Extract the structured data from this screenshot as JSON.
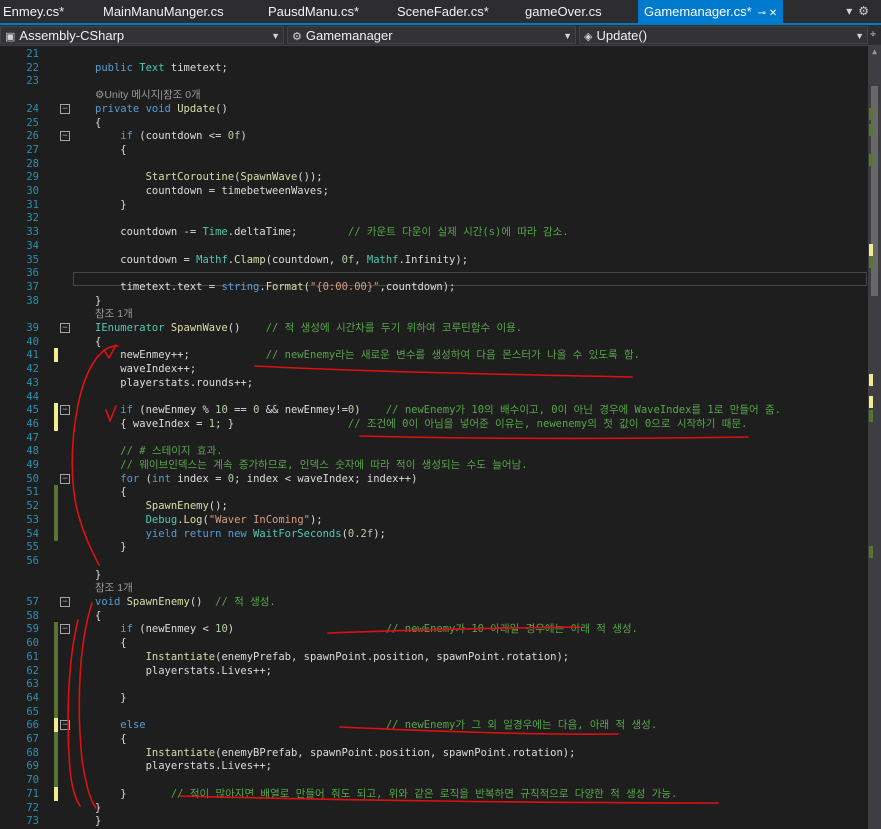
{
  "tabs": [
    {
      "label": "Enmey.cs*",
      "active": false
    },
    {
      "label": "MainManuManger.cs",
      "active": false
    },
    {
      "label": "PausdManu.cs*",
      "active": false
    },
    {
      "label": "SceneFader.cs*",
      "active": false
    },
    {
      "label": "gameOver.cs",
      "active": false
    },
    {
      "label": "Gamemanager.cs*",
      "active": true
    }
  ],
  "navbar": {
    "project": "Assembly-CSharp",
    "class": "Gamemanager",
    "member": "Update()"
  },
  "colors": {
    "accent": "#007acc",
    "editor_bg": "#1e1e1e",
    "annotation_ink": "#e01010",
    "keyword": "#569cd6",
    "type": "#4ec9b0",
    "comment": "#57a64a"
  },
  "lines": [
    {
      "n": "21",
      "segs": []
    },
    {
      "n": "22",
      "segs": [
        [
          "kw",
          "public "
        ],
        [
          "type",
          "Text "
        ],
        [
          "plain",
          "timetext;"
        ]
      ]
    },
    {
      "n": "23",
      "segs": []
    },
    {
      "lens": "⚙Unity 메시지|참조 0개"
    },
    {
      "n": "24",
      "fold": true,
      "segs": [
        [
          "kw",
          "private "
        ],
        [
          "kw",
          "void "
        ],
        [
          "fn",
          "Update"
        ],
        [
          "plain",
          "()"
        ]
      ]
    },
    {
      "n": "25",
      "segs": [
        [
          "plain",
          "{"
        ]
      ]
    },
    {
      "n": "26",
      "fold": true,
      "segs": [
        [
          "plain",
          "    "
        ],
        [
          "kw",
          "if "
        ],
        [
          "plain",
          "(countdown <= "
        ],
        [
          "num",
          "0f"
        ],
        [
          "plain",
          ")"
        ]
      ]
    },
    {
      "n": "27",
      "segs": [
        [
          "plain",
          "    {"
        ]
      ]
    },
    {
      "n": "28",
      "segs": []
    },
    {
      "n": "29",
      "segs": [
        [
          "plain",
          "        "
        ],
        [
          "fn",
          "StartCoroutine"
        ],
        [
          "plain",
          "("
        ],
        [
          "fn",
          "SpawnWave"
        ],
        [
          "plain",
          "());"
        ]
      ]
    },
    {
      "n": "30",
      "segs": [
        [
          "plain",
          "        countdown = timebetweenWaves;"
        ]
      ]
    },
    {
      "n": "31",
      "segs": [
        [
          "plain",
          "    }"
        ]
      ]
    },
    {
      "n": "32",
      "segs": []
    },
    {
      "n": "33",
      "segs": [
        [
          "plain",
          "    countdown -= "
        ],
        [
          "type",
          "Time"
        ],
        [
          "plain",
          ".deltaTime;        "
        ],
        [
          "cmt",
          "// 카운트 다운이 실제 시간(s)에 따라 감소."
        ]
      ]
    },
    {
      "n": "34",
      "segs": []
    },
    {
      "n": "35",
      "segs": [
        [
          "plain",
          "    countdown = "
        ],
        [
          "type",
          "Mathf"
        ],
        [
          "plain",
          "."
        ],
        [
          "fn",
          "Clamp"
        ],
        [
          "plain",
          "(countdown, "
        ],
        [
          "num",
          "0f"
        ],
        [
          "plain",
          ", "
        ],
        [
          "type",
          "Mathf"
        ],
        [
          "plain",
          ".Infinity);"
        ]
      ]
    },
    {
      "n": "36",
      "segs": []
    },
    {
      "n": "37",
      "segs": [
        [
          "plain",
          "    timetext.text = "
        ],
        [
          "kw",
          "string"
        ],
        [
          "plain",
          "."
        ],
        [
          "fn",
          "Format"
        ],
        [
          "plain",
          "("
        ],
        [
          "str",
          "\"{0:00.00}\""
        ],
        [
          "plain",
          ",countdown);"
        ]
      ]
    },
    {
      "n": "38",
      "segs": [
        [
          "plain",
          "}"
        ]
      ]
    },
    {
      "lens": "참조 1개"
    },
    {
      "n": "39",
      "fold": true,
      "segs": [
        [
          "type",
          "IEnumerator "
        ],
        [
          "fn",
          "SpawnWave"
        ],
        [
          "plain",
          "()    "
        ],
        [
          "cmt",
          "// 적 생성에 시간차를 두기 위하여 코루틴함수 이용."
        ]
      ]
    },
    {
      "n": "40",
      "segs": [
        [
          "plain",
          "{"
        ]
      ]
    },
    {
      "n": "41",
      "segs": [
        [
          "plain",
          "    newEnmey++;            "
        ],
        [
          "cmt",
          "// newEnemy라는 새로운 변수를 생성하여 다음 몬스터가 나올 수 있도록 함."
        ]
      ]
    },
    {
      "n": "42",
      "segs": [
        [
          "plain",
          "    waveIndex++;"
        ]
      ]
    },
    {
      "n": "43",
      "segs": [
        [
          "plain",
          "    playerstats.rounds++;"
        ]
      ]
    },
    {
      "n": "44",
      "segs": []
    },
    {
      "n": "45",
      "fold": true,
      "segs": [
        [
          "plain",
          "    "
        ],
        [
          "kw",
          "if "
        ],
        [
          "plain",
          "(newEnmey % "
        ],
        [
          "num",
          "10"
        ],
        [
          "plain",
          " == "
        ],
        [
          "num",
          "0"
        ],
        [
          "plain",
          " && newEnmey!="
        ],
        [
          "num",
          "0"
        ],
        [
          "plain",
          ")    "
        ],
        [
          "cmt",
          "// newEnemy가 10의 배수이고, 0이 아닌 경우에 WaveIndex를 1로 만들어 줌."
        ]
      ]
    },
    {
      "n": "46",
      "segs": [
        [
          "plain",
          "    { waveIndex = "
        ],
        [
          "num",
          "1"
        ],
        [
          "plain",
          "; }                  "
        ],
        [
          "cmt",
          "// 조건에 0이 아님을 넣어준 이유는, newenemy의 첫 값이 0으로 시작하기 때문."
        ]
      ]
    },
    {
      "n": "47",
      "segs": []
    },
    {
      "n": "48",
      "segs": [
        [
          "plain",
          "    "
        ],
        [
          "cmt",
          "// # 스테이지 효과."
        ]
      ]
    },
    {
      "n": "49",
      "segs": [
        [
          "plain",
          "    "
        ],
        [
          "cmt",
          "// 웨이브인덱스는 계속 증가하므로, 인덱스 숫자에 따라 적이 생성되는 수도 늘어남."
        ]
      ]
    },
    {
      "n": "50",
      "fold": true,
      "segs": [
        [
          "plain",
          "    "
        ],
        [
          "kw",
          "for "
        ],
        [
          "plain",
          "("
        ],
        [
          "kw",
          "int "
        ],
        [
          "plain",
          "index = "
        ],
        [
          "num",
          "0"
        ],
        [
          "plain",
          "; index < waveIndex; index++)"
        ]
      ]
    },
    {
      "n": "51",
      "segs": [
        [
          "plain",
          "    {"
        ]
      ]
    },
    {
      "n": "52",
      "segs": [
        [
          "plain",
          "        "
        ],
        [
          "fn",
          "SpawnEnemy"
        ],
        [
          "plain",
          "();"
        ]
      ]
    },
    {
      "n": "53",
      "segs": [
        [
          "plain",
          "        "
        ],
        [
          "type",
          "Debug"
        ],
        [
          "plain",
          "."
        ],
        [
          "fn",
          "Log"
        ],
        [
          "plain",
          "("
        ],
        [
          "str",
          "\"Waver InComing\""
        ],
        [
          "plain",
          ");"
        ]
      ]
    },
    {
      "n": "54",
      "segs": [
        [
          "plain",
          "        "
        ],
        [
          "kw",
          "yield return new "
        ],
        [
          "type",
          "WaitForSeconds"
        ],
        [
          "plain",
          "("
        ],
        [
          "num",
          "0.2f"
        ],
        [
          "plain",
          ");"
        ]
      ]
    },
    {
      "n": "55",
      "segs": [
        [
          "plain",
          "    }"
        ]
      ]
    },
    {
      "n": "56",
      "segs": []
    },
    {
      "n": "",
      "segs": [
        [
          "plain",
          "}"
        ]
      ]
    },
    {
      "lens": "참조 1개"
    },
    {
      "n": "57",
      "fold": true,
      "segs": [
        [
          "kw",
          "void "
        ],
        [
          "fn",
          "SpawnEnemy"
        ],
        [
          "plain",
          "()  "
        ],
        [
          "cmt",
          "// 적 생성."
        ]
      ]
    },
    {
      "n": "58",
      "segs": [
        [
          "plain",
          "{"
        ]
      ]
    },
    {
      "n": "59",
      "fold": true,
      "segs": [
        [
          "plain",
          "    "
        ],
        [
          "kw",
          "if "
        ],
        [
          "plain",
          "(newEnmey < "
        ],
        [
          "num",
          "10"
        ],
        [
          "plain",
          ")                        "
        ],
        [
          "cmt",
          "// newEnemy가 10 아래일 경우에는 아래 적 생성."
        ]
      ]
    },
    {
      "n": "60",
      "segs": [
        [
          "plain",
          "    {"
        ]
      ]
    },
    {
      "n": "61",
      "segs": [
        [
          "plain",
          "        "
        ],
        [
          "fn",
          "Instantiate"
        ],
        [
          "plain",
          "(enemyPrefab, spawnPoint.position, spawnPoint.rotation);"
        ]
      ]
    },
    {
      "n": "62",
      "segs": [
        [
          "plain",
          "        playerstats.Lives++;"
        ]
      ]
    },
    {
      "n": "63",
      "segs": []
    },
    {
      "n": "64",
      "segs": [
        [
          "plain",
          "    }"
        ]
      ]
    },
    {
      "n": "65",
      "segs": []
    },
    {
      "n": "66",
      "fold": true,
      "segs": [
        [
          "plain",
          "    "
        ],
        [
          "kw",
          "else"
        ],
        [
          "plain",
          "                                      "
        ],
        [
          "cmt",
          "// newEnemy가 그 외 일경우에는 다음, 아래 적 생성."
        ]
      ]
    },
    {
      "n": "67",
      "segs": [
        [
          "plain",
          "    {"
        ]
      ]
    },
    {
      "n": "68",
      "segs": [
        [
          "plain",
          "        "
        ],
        [
          "fn",
          "Instantiate"
        ],
        [
          "plain",
          "(enemyBPrefab, spawnPoint.position, spawnPoint.rotation);"
        ]
      ]
    },
    {
      "n": "69",
      "segs": [
        [
          "plain",
          "        playerstats.Lives++;"
        ]
      ]
    },
    {
      "n": "70",
      "segs": []
    },
    {
      "n": "71",
      "segs": [
        [
          "plain",
          "    }       "
        ],
        [
          "cmt",
          "// 적이 많아지면 배열로 만들어 줘도 되고, 위와 같은 로직을 반복하면 규칙적으로 다양한 적 생성 가능."
        ]
      ]
    },
    {
      "n": "72",
      "segs": [
        [
          "plain",
          "}"
        ]
      ]
    },
    {
      "n": "73",
      "segs": [
        [
          "plain",
          "}"
        ]
      ]
    }
  ]
}
